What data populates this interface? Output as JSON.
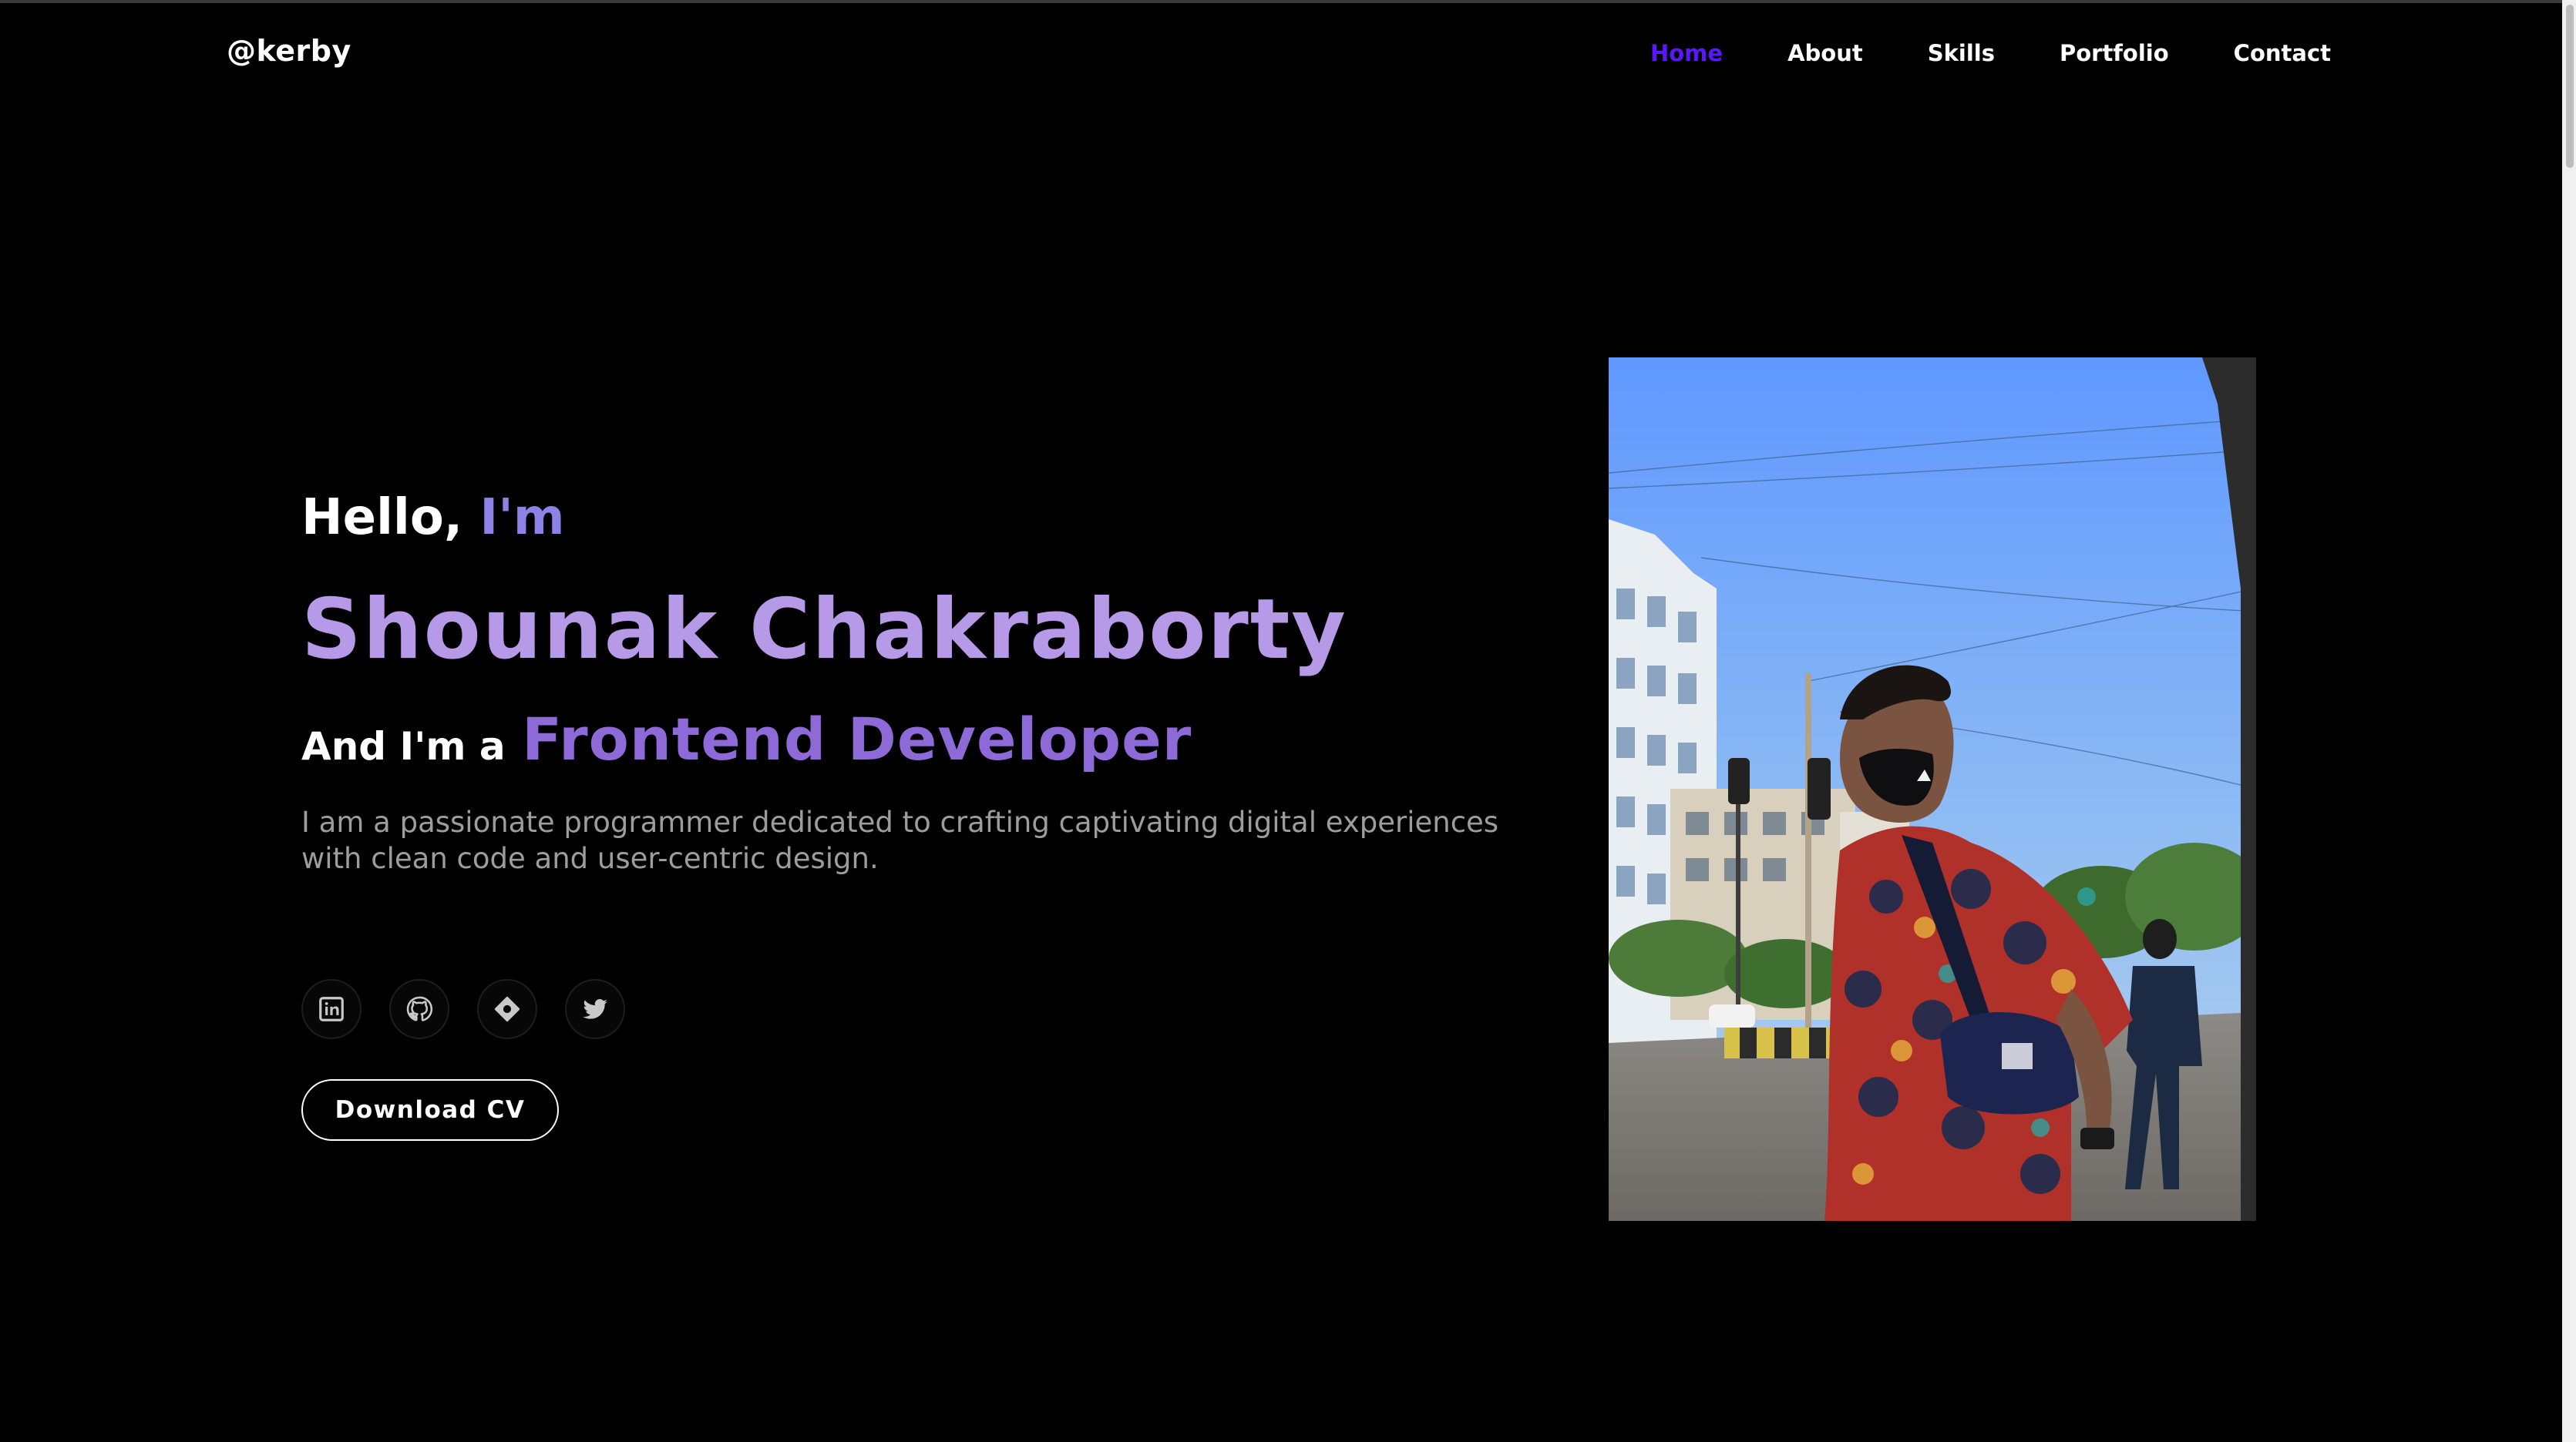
{
  "header": {
    "logo": "@kerby",
    "nav": [
      {
        "label": "Home",
        "active": true
      },
      {
        "label": "About",
        "active": false
      },
      {
        "label": "Skills",
        "active": false
      },
      {
        "label": "Portfolio",
        "active": false
      },
      {
        "label": "Contact",
        "active": false
      }
    ]
  },
  "hero": {
    "greeting": "Hello,",
    "greeting_accent": "I'm",
    "name": "Shounak Chakraborty",
    "role_prefix": "And I'm a",
    "role": "Frontend Developer",
    "description": "I am a passionate programmer dedicated to crafting captivating digital experiences with clean code and user-centric design.",
    "socials": [
      {
        "icon": "linkedin-icon"
      },
      {
        "icon": "github-icon"
      },
      {
        "icon": "hashnode-icon"
      },
      {
        "icon": "twitter-icon"
      }
    ],
    "cv_button": "Download CV"
  },
  "colors": {
    "background": "#000000",
    "nav_active": "#5a17ff",
    "accent_light": "#b69ae8",
    "accent": "#8d6ad8",
    "muted_text": "#9d9d9d"
  }
}
